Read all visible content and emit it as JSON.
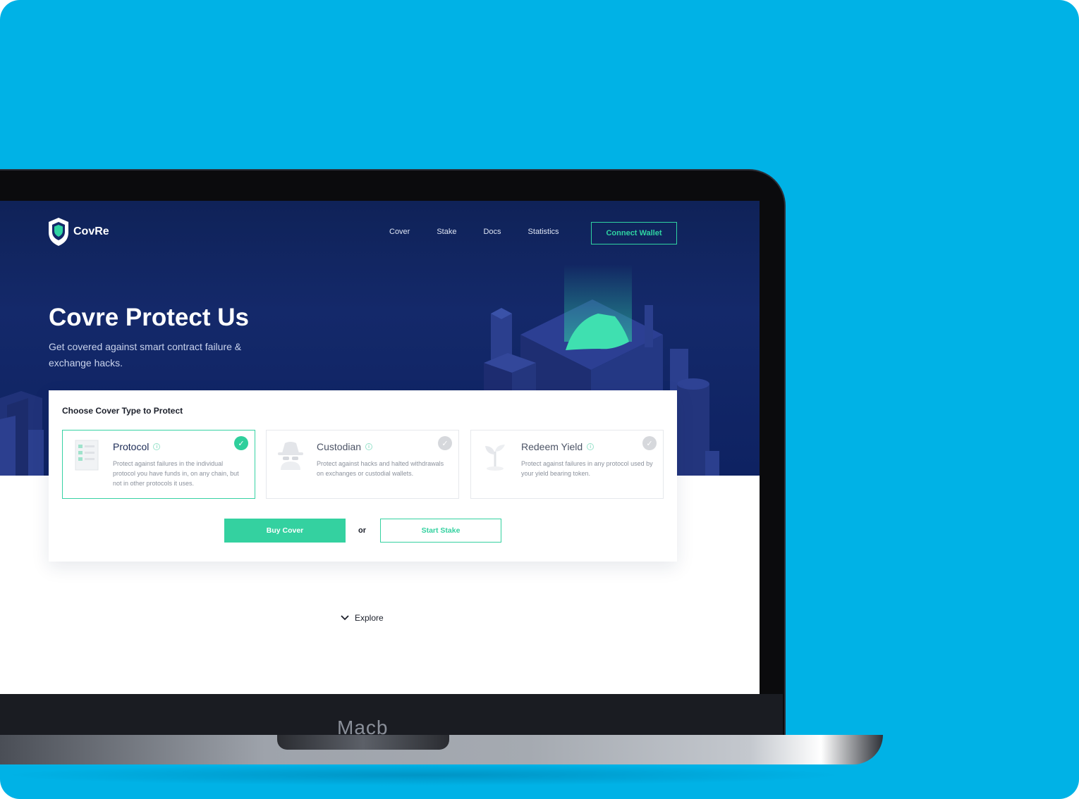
{
  "device": {
    "label": "Macb"
  },
  "header": {
    "logo_text": "CovRe",
    "nav": [
      {
        "label": "Cover"
      },
      {
        "label": "Stake"
      },
      {
        "label": "Docs"
      },
      {
        "label": "Statistics"
      }
    ],
    "connect_label": "Connect Wallet"
  },
  "hero": {
    "title": "Covre Protect Us",
    "subtitle": "Get covered against smart contract failure & exchange hacks."
  },
  "cover_card": {
    "title": "Choose Cover Type to Protect",
    "options": [
      {
        "name": "Protocol",
        "description": "Protect against failures in the individual protocol you have funds in, on any chain, but not in other protocols it uses.",
        "selected": true,
        "icon": "document-icon"
      },
      {
        "name": "Custodian",
        "description": "Protect against hacks and halted withdrawals on exchanges or custodial wallets.",
        "selected": false,
        "icon": "spy-icon"
      },
      {
        "name": "Redeem Yield",
        "description": "Protect against failures in any protocol used by your yield bearing token.",
        "selected": false,
        "icon": "sprout-icon"
      }
    ],
    "buy_label": "Buy Cover",
    "or_label": "or",
    "stake_label": "Start Stake"
  },
  "explore": {
    "label": "Explore"
  },
  "colors": {
    "background": "#00b2e6",
    "hero": "#14296a",
    "accent": "#34d1a0"
  }
}
